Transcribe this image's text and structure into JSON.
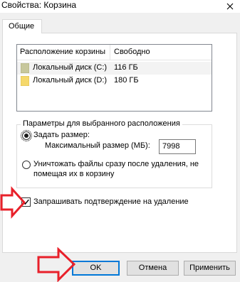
{
  "window": {
    "title": "Свойства: Корзина"
  },
  "tabs": [
    {
      "label": "Общие"
    }
  ],
  "locations_list": {
    "columns": [
      "Расположение корзины",
      "Свободно"
    ],
    "rows": [
      {
        "name": "Локальный диск (C:)",
        "free": "116 ГБ",
        "selected": true
      },
      {
        "name": "Локальный диск (D:)",
        "free": "180 ГБ",
        "selected": false
      }
    ]
  },
  "settings_group": {
    "title": "Параметры для выбранного расположения",
    "option_custom_size": {
      "label": "Задать размер:",
      "checked": true
    },
    "max_size_label": "Максимальный размер (МБ):",
    "max_size_value": "7998",
    "option_delete_immediately": {
      "label_line1": "Уничтожать файлы сразу после удаления, не",
      "label_line2": "помещая их в корзину",
      "checked": false
    }
  },
  "confirm_delete": {
    "label": "Запрашивать подтверждение на удаление",
    "checked": true
  },
  "buttons": {
    "ok": "OK",
    "cancel": "Отмена",
    "apply": "Применить"
  },
  "colors": {
    "annotation_arrow": "#e8202a",
    "focus_blue": "#0078d7",
    "drive_c_folder": "#c7c79c",
    "drive_d_folder": "#f5d86b"
  }
}
